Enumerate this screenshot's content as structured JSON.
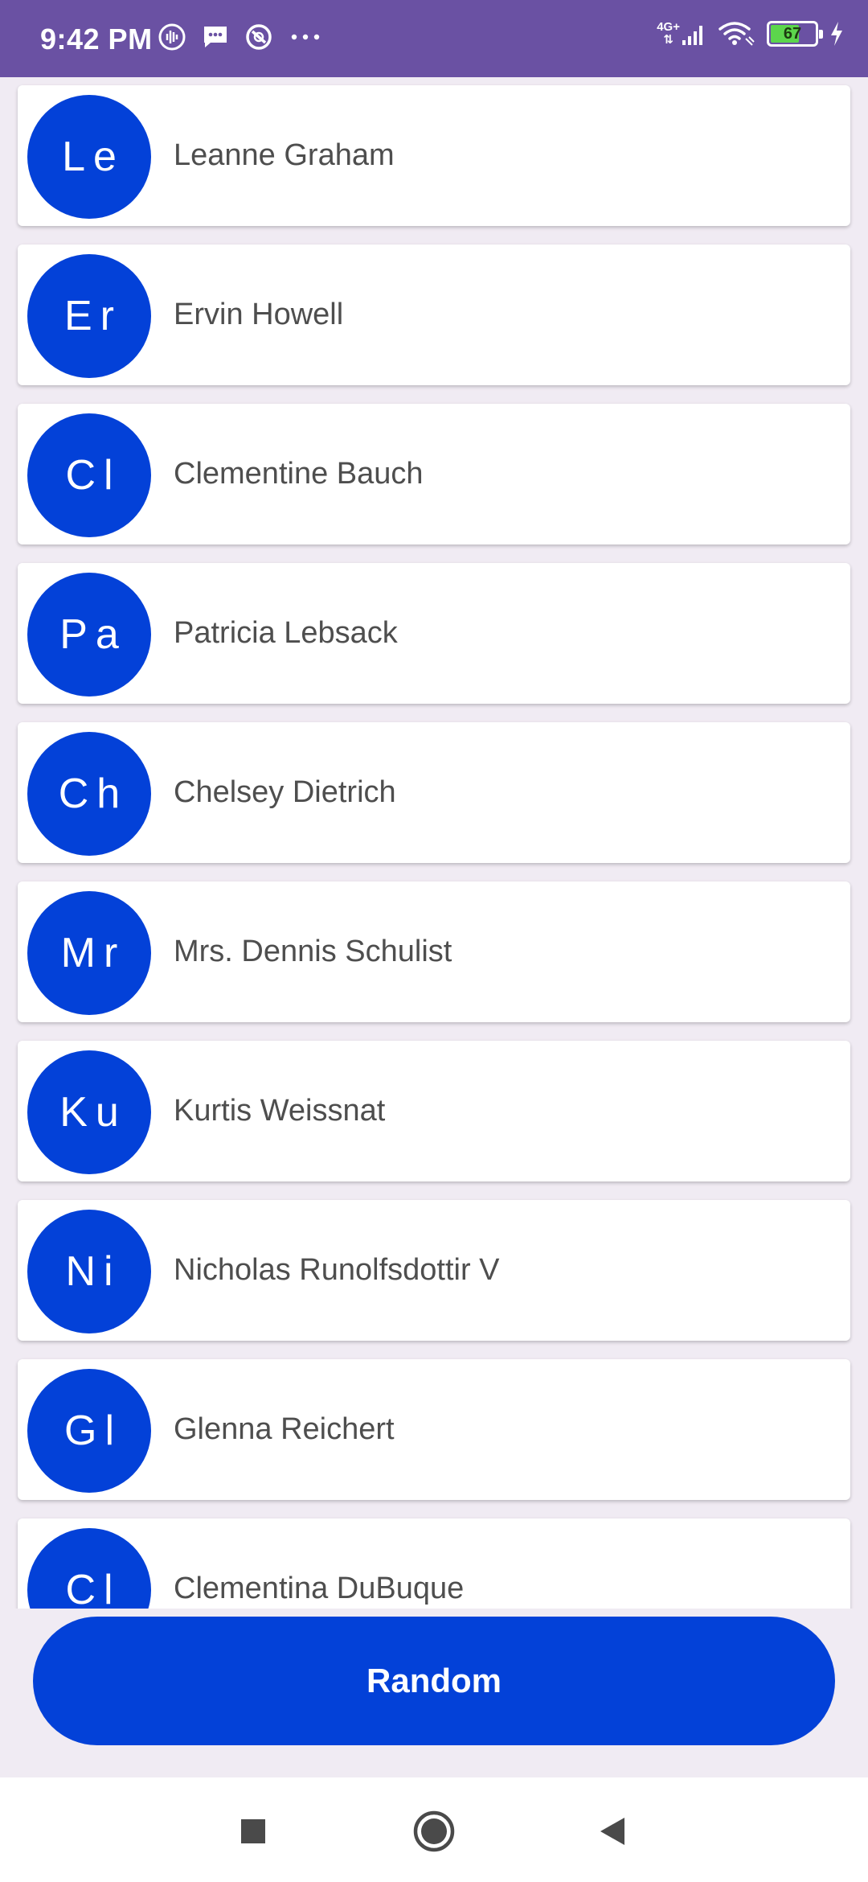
{
  "status_bar": {
    "time": "9:42 PM",
    "left_icons": [
      "voice-notification-icon",
      "message-icon",
      "do-not-disturb-icon",
      "more-dots-icon"
    ],
    "network_label_top": "4G+",
    "network_label_bottom": "⇅",
    "battery_level": "67",
    "colors": {
      "background": "#6a51a3",
      "battery_fill": "#5cd64c"
    }
  },
  "users": [
    {
      "initials": "Le",
      "name": "Leanne Graham"
    },
    {
      "initials": "Er",
      "name": "Ervin Howell"
    },
    {
      "initials": "Cl",
      "name": "Clementine Bauch"
    },
    {
      "initials": "Pa",
      "name": "Patricia Lebsack"
    },
    {
      "initials": "Ch",
      "name": "Chelsey Dietrich"
    },
    {
      "initials": "Mr",
      "name": "Mrs. Dennis Schulist"
    },
    {
      "initials": "Ku",
      "name": "Kurtis Weissnat"
    },
    {
      "initials": "Ni",
      "name": "Nicholas Runolfsdottir V"
    },
    {
      "initials": "Gl",
      "name": "Glenna Reichert"
    },
    {
      "initials": "Cl",
      "name": "Clementina DuBuque"
    }
  ],
  "random_button": {
    "label": "Random"
  },
  "nav_bar": {
    "icons": [
      "recents-square-icon",
      "home-circle-icon",
      "back-triangle-icon"
    ]
  },
  "colors": {
    "accent": "#0341d8",
    "page_background": "#f0ebf3",
    "card": "#ffffff",
    "name_text": "#4e4e4e"
  }
}
